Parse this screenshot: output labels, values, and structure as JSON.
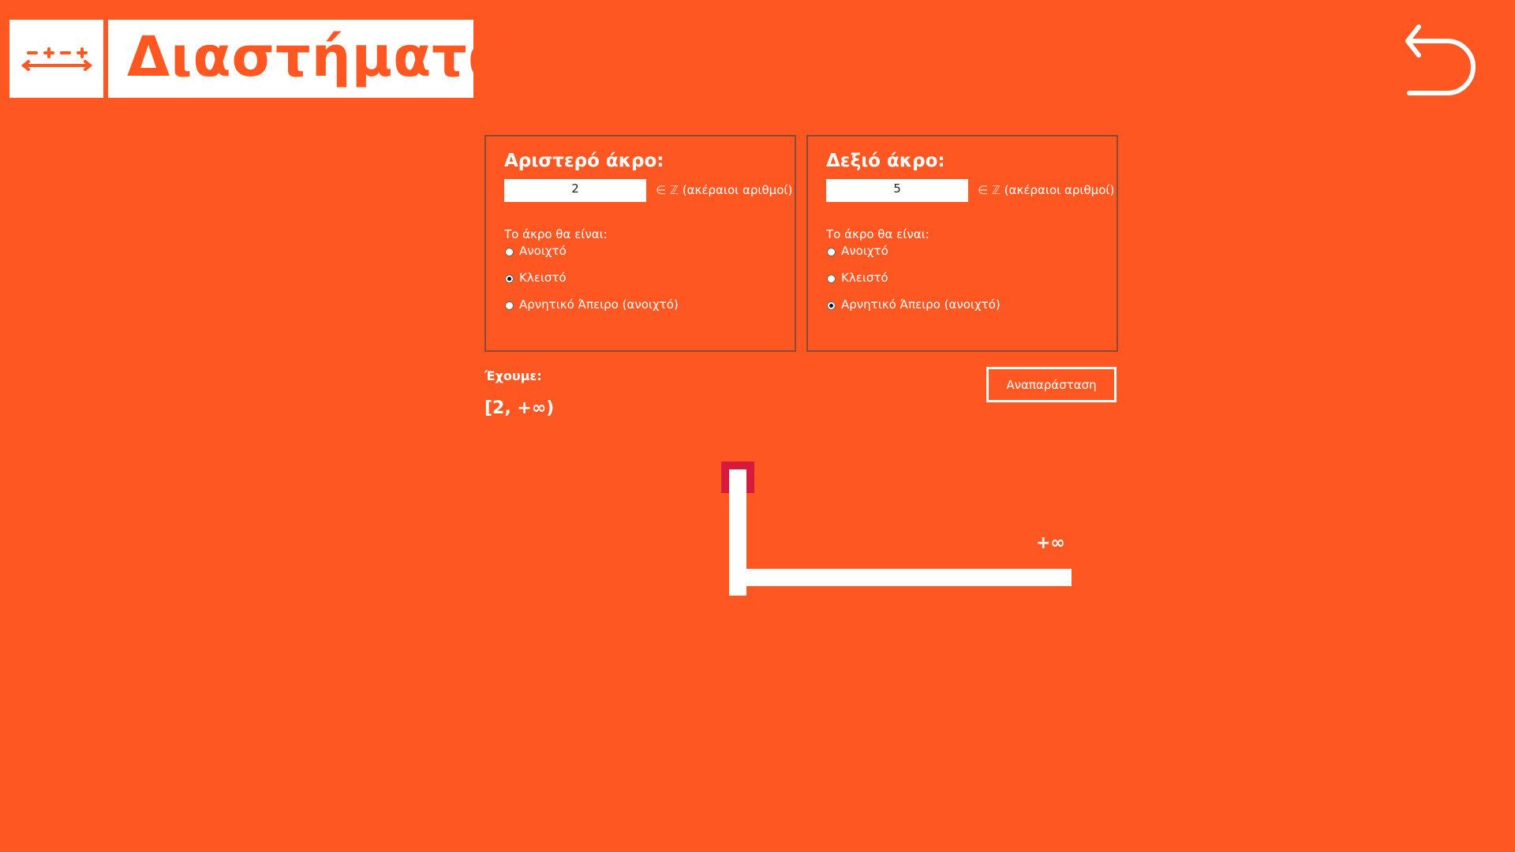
{
  "header": {
    "logo_icon": "number-line-icon",
    "title": "Διαστήματα",
    "back_icon": "undo-arrow-icon"
  },
  "left_endpoint": {
    "title": "Αριστερό άκρο:",
    "value": "2",
    "set_symbol": "∈ ℤ",
    "set_text": "(ακέραιοι αριθμοί)",
    "type_label": "Το άκρο θα είναι:",
    "options": [
      "Ανοιχτό",
      "Κλειστό",
      "Αρνητικό Άπειρο (ανοιχτό)"
    ],
    "selected": "Κλειστό"
  },
  "right_endpoint": {
    "title": "Δεξιό άκρο:",
    "value": "5",
    "set_symbol": "∈ ℤ",
    "set_text": "(ακέραιοι αριθμοί)",
    "type_label": "Το άκρο θα είναι:",
    "options": [
      "Ανοιχτό",
      "Κλειστό",
      "Αρνητικό Άπειρο (ανοιχτό)"
    ],
    "selected": "Αρνητικό Άπειρο (ανοιχτό)"
  },
  "result": {
    "label": "Έχουμε:",
    "interval": "[2, +∞)"
  },
  "draw_button": "Αναπαράσταση",
  "graph": {
    "right_label": "+∞"
  },
  "colors": {
    "background": "#ff5722",
    "foreground": "#ffffff",
    "marker": "#d81b3c"
  }
}
